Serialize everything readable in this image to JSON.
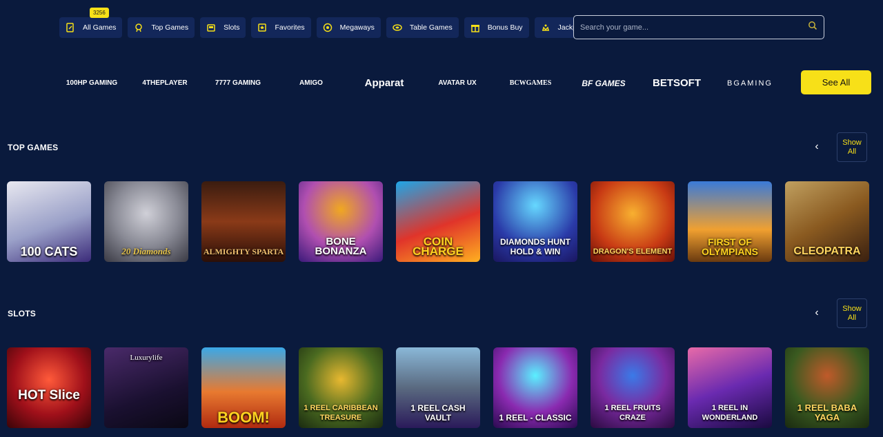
{
  "nav": {
    "badge": "3256",
    "items": [
      {
        "label": "All Games",
        "icon": "all-games-icon"
      },
      {
        "label": "Top Games",
        "icon": "top-games-icon"
      },
      {
        "label": "Slots",
        "icon": "slots-icon"
      },
      {
        "label": "Favorites",
        "icon": "favorites-icon"
      },
      {
        "label": "Megaways",
        "icon": "megaways-icon"
      },
      {
        "label": "Table Games",
        "icon": "table-games-icon"
      },
      {
        "label": "Bonus Buy",
        "icon": "bonus-buy-icon"
      },
      {
        "label": "Jackpot",
        "icon": "jackpot-icon"
      }
    ]
  },
  "search": {
    "placeholder": "Search your game..."
  },
  "providers": {
    "items": [
      "100HP GAMING",
      "4THEPLAYER",
      "7777 GAMING",
      "AMIGO",
      "Apparat",
      "AVATAR UX",
      "BCWGAMES",
      "BF GAMES",
      "BETSOFT",
      "BGAMING"
    ],
    "see_all": "See All"
  },
  "top_games": {
    "title": "TOP GAMES",
    "show_all": "Show All",
    "games": [
      "100 CATS",
      "20 Diamonds",
      "ALMIGHTY SPARTA",
      "BONE BONANZA",
      "COIN CHARGE",
      "DIAMONDS HUNT HOLD & WIN",
      "DRAGON'S ELEMENT",
      "FIRST OF OLYMPIANS",
      "CLEOPATRA"
    ]
  },
  "slots": {
    "title": "SLOTS",
    "show_all": "Show All",
    "games": [
      "HOT Slice",
      "Luxurylife",
      "BOOM!",
      "1 REEL CARIBBEAN TREASURE",
      "1 REEL CASH VAULT",
      "1 REEL - CLASSIC",
      "1 REEL FRUITS CRAZE",
      "1 REEL IN WONDERLAND",
      "1 REEL BABA YAGA"
    ]
  },
  "colors": {
    "accent": "#f7e018",
    "background": "#0a1a3d",
    "nav_button": "#13275a"
  }
}
